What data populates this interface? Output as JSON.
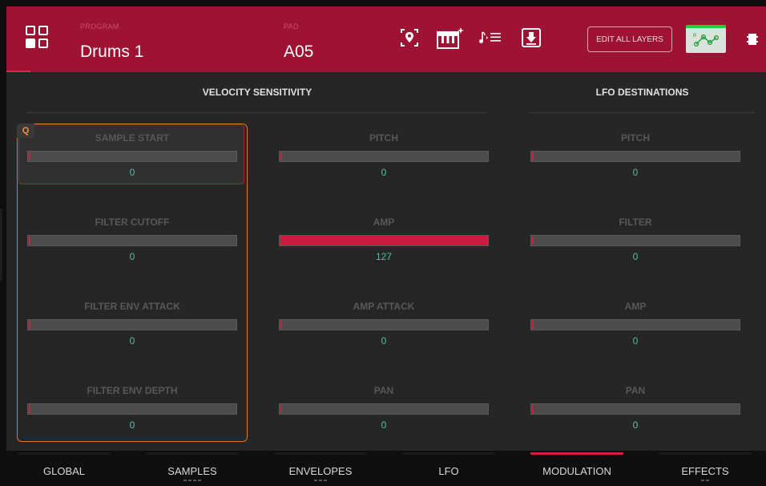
{
  "header": {
    "program_label": "PROGRAM",
    "program_value": "Drums 1",
    "pad_label": "PAD",
    "pad_value": "A05",
    "edit_all_layers": "EDIT ALL LAYERS"
  },
  "q_badge": "Q",
  "sections": {
    "velocity": {
      "title": "VELOCITY SENSITIVITY"
    },
    "lfo": {
      "title": "LFO  DESTINATIONS"
    }
  },
  "columns": [
    {
      "params": [
        {
          "label": "SAMPLE START",
          "value": "0"
        },
        {
          "label": "FILTER CUTOFF",
          "value": "0"
        },
        {
          "label": "FILTER ENV ATTACK",
          "value": "0"
        },
        {
          "label": "FILTER ENV DEPTH",
          "value": "0"
        }
      ]
    },
    {
      "params": [
        {
          "label": "PITCH",
          "value": "0"
        },
        {
          "label": "AMP",
          "value": "127"
        },
        {
          "label": "AMP ATTACK",
          "value": "0"
        },
        {
          "label": "PAN",
          "value": "0"
        }
      ]
    },
    {
      "params": [
        {
          "label": "PITCH",
          "value": "0"
        },
        {
          "label": "FILTER",
          "value": "0"
        },
        {
          "label": "AMP",
          "value": "0"
        },
        {
          "label": "PAN",
          "value": "0"
        }
      ]
    }
  ],
  "amp_fill_fraction": 1.0,
  "tabs": [
    {
      "label": "GLOBAL",
      "dots": 0
    },
    {
      "label": "SAMPLES",
      "dots": 4
    },
    {
      "label": "ENVELOPES",
      "dots": 3
    },
    {
      "label": "LFO",
      "dots": 0
    },
    {
      "label": "MODULATION",
      "dots": 0,
      "active": true
    },
    {
      "label": "EFFECTS",
      "dots": 2
    }
  ],
  "colors": {
    "header_bg": "#9e1233",
    "value_text": "#4fc0a4",
    "accent_red": "#cd1b3f",
    "q_group_border": "#d9772b",
    "mod_route_green": "#1fcf3a"
  }
}
